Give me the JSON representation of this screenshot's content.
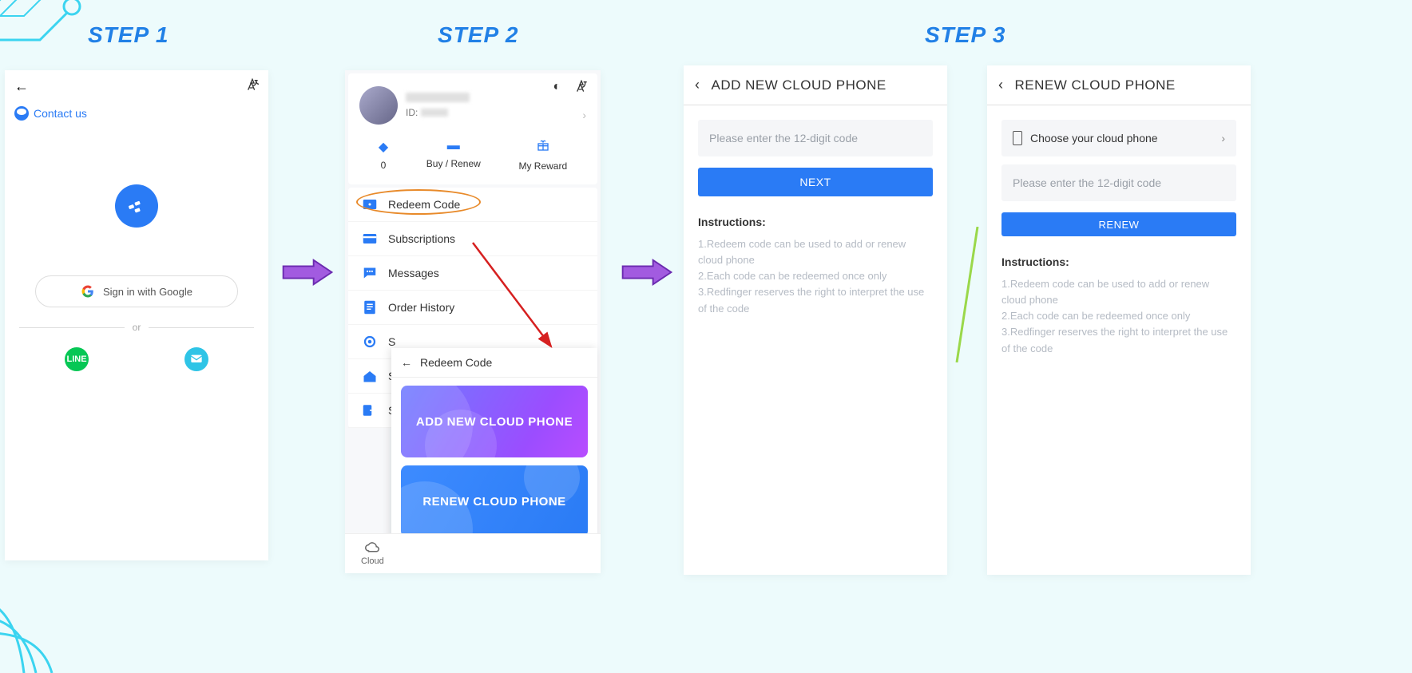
{
  "steps": {
    "s1": "STEP 1",
    "s2": "STEP 2",
    "s3": "STEP 3"
  },
  "screen1": {
    "contact": "Contact us",
    "google": "Sign in with Google",
    "or": "or"
  },
  "screen2": {
    "id_label": "ID:",
    "stats": {
      "points": "0",
      "buy": "Buy / Renew",
      "reward": "My Reward"
    },
    "menu": {
      "redeem": "Redeem Code",
      "subs": "Subscriptions",
      "msgs": "Messages",
      "order": "Order History",
      "s1": "S",
      "s2": "S",
      "s3": "S"
    },
    "overlay": {
      "title": "Redeem Code",
      "add": "ADD NEW CLOUD PHONE",
      "renew": "RENEW CLOUD PHONE"
    },
    "bottom_nav": "Cloud"
  },
  "screen3a": {
    "title": "ADD NEW CLOUD PHONE",
    "placeholder": "Please enter the 12-digit code",
    "next": "NEXT",
    "instr_head": "Instructions:",
    "instr1": "1.Redeem code can be used to add or renew cloud phone",
    "instr2": "2.Each code can be redeemed once only",
    "instr3": "3.Redfinger reserves the right to interpret the use of the code"
  },
  "screen3b": {
    "title": "RENEW CLOUD PHONE",
    "choose": "Choose your cloud phone",
    "placeholder": "Please enter the 12-digit code",
    "renew": "RENEW",
    "instr_head": "Instructions:",
    "instr1": "1.Redeem code can be used to add or renew cloud phone",
    "instr2": "2.Each code can be redeemed once only",
    "instr3": "3.Redfinger reserves the right to interpret the use of the code"
  }
}
